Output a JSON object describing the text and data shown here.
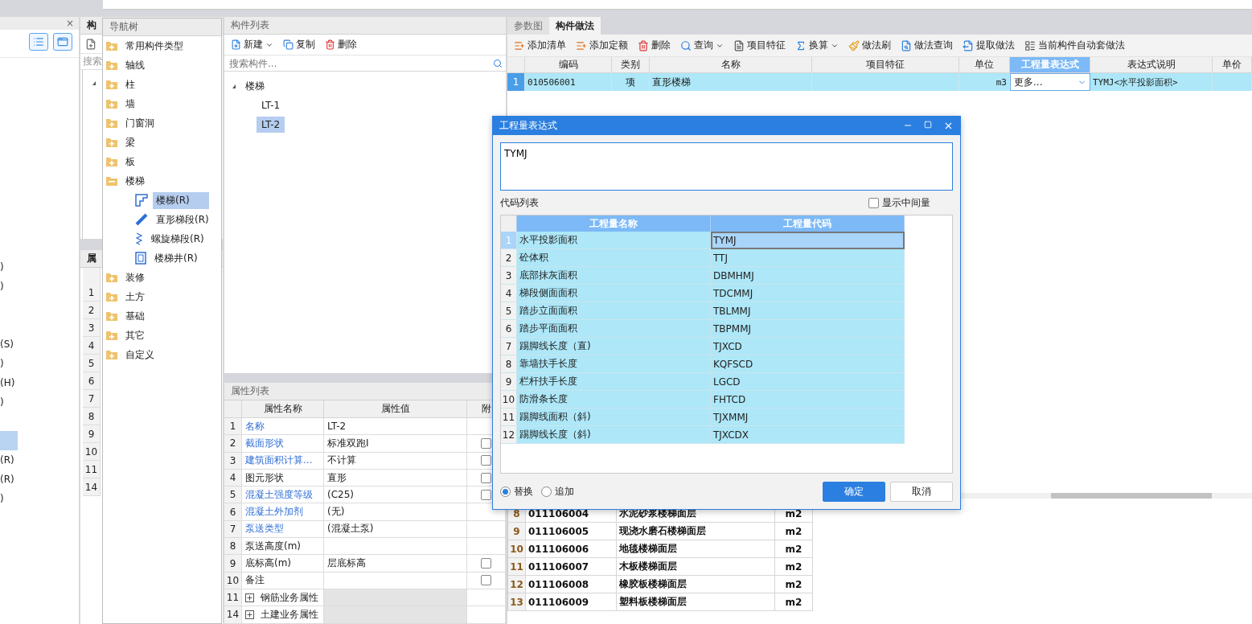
{
  "left_panel": {
    "close": "×",
    "rows": [
      {
        "text": ")",
        "selected": false
      },
      {
        "text": ")",
        "selected": false
      },
      {
        "selected": false
      },
      {
        "selected": false
      },
      {
        "text": "(S)",
        "selected": false
      },
      {
        "text": ")",
        "selected": false
      },
      {
        "text": "(H)",
        "selected": false
      },
      {
        "text": ")",
        "selected": false
      },
      {
        "selected": false
      },
      {
        "selected": true
      },
      {
        "text": "(R)",
        "selected": false
      },
      {
        "text": "(R)",
        "selected": false
      },
      {
        "text": ")",
        "selected": false
      }
    ]
  },
  "component_panel": {
    "title": "构",
    "search": {
      "placeholder": "搜索"
    },
    "properties_title": "属",
    "row_numbers": [
      "1",
      "2",
      "3",
      "4",
      "5",
      "6",
      "7",
      "8",
      "9",
      "10",
      "11",
      "14"
    ]
  },
  "nav_tree": {
    "title": "导航树",
    "items": [
      {
        "label": "常用构件类型",
        "expanded": false
      },
      {
        "label": "轴线",
        "expanded": false
      },
      {
        "label": "柱",
        "expanded": false
      },
      {
        "label": "墙",
        "expanded": false
      },
      {
        "label": "门窗洞",
        "expanded": false
      },
      {
        "label": "梁",
        "expanded": false
      },
      {
        "label": "板",
        "expanded": false
      },
      {
        "label": "楼梯",
        "expanded": true,
        "children": [
          {
            "label": "楼梯(R)",
            "selected": true
          },
          {
            "label": "直形梯段(R)",
            "selected": false
          },
          {
            "label": "螺旋梯段(R)",
            "selected": false
          },
          {
            "label": "楼梯井(R)",
            "selected": false
          }
        ]
      },
      {
        "label": "装修",
        "expanded": false
      },
      {
        "label": "土方",
        "expanded": false
      },
      {
        "label": "基础",
        "expanded": false
      },
      {
        "label": "其它",
        "expanded": false
      },
      {
        "label": "自定义",
        "expanded": false
      }
    ]
  },
  "component_list": {
    "title": "构件列表",
    "toolbar": [
      {
        "label": "新建",
        "dropdown": true
      },
      {
        "label": "复制",
        "dropdown": false
      },
      {
        "label": "删除",
        "dropdown": false
      }
    ],
    "search": {
      "placeholder": "搜索构件..."
    },
    "tree": [
      {
        "label": "楼梯",
        "expanded": true,
        "children": [
          {
            "label": "LT-1",
            "selected": false
          },
          {
            "label": "LT-2",
            "selected": true
          }
        ]
      }
    ]
  },
  "property_list": {
    "title": "属性列表",
    "columns": [
      "属性名称",
      "属性值",
      "附"
    ],
    "rows": [
      {
        "num": "1",
        "kind": "field",
        "name": "名称",
        "value": "LT-2",
        "public": true
      },
      {
        "num": "2",
        "kind": "field",
        "name": "截面形状",
        "value": "标准双跑I",
        "public": true,
        "checked": false
      },
      {
        "num": "3",
        "kind": "field",
        "name": "建筑面积计算...",
        "value": "不计算",
        "public": true,
        "checked": false
      },
      {
        "num": "4",
        "kind": "field",
        "name": "图元形状",
        "value": "直形",
        "public": false,
        "checked": false
      },
      {
        "num": "5",
        "kind": "field",
        "name": "混凝土强度等级",
        "value": "(C25)",
        "public": true,
        "checked": false
      },
      {
        "num": "6",
        "kind": "field",
        "name": "混凝土外加剂",
        "value": "(无)",
        "public": true
      },
      {
        "num": "7",
        "kind": "field",
        "name": "泵送类型",
        "value": "(混凝土泵)",
        "public": true
      },
      {
        "num": "8",
        "kind": "field",
        "name": "泵送高度(m)",
        "public": false
      },
      {
        "num": "9",
        "kind": "field",
        "name": "底标高(m)",
        "value": "层底标高",
        "public": false,
        "checked": false
      },
      {
        "num": "10",
        "kind": "field",
        "name": "备注",
        "public": false,
        "checked": false
      },
      {
        "num": "11",
        "kind": "group",
        "name": "钢筋业务属性",
        "public": false
      },
      {
        "num": "14",
        "kind": "group",
        "name": "土建业务属性",
        "public": false
      }
    ]
  },
  "method_panel": {
    "tabs": [
      {
        "label": "参数图",
        "selected": false
      },
      {
        "label": "构件做法",
        "selected": true
      }
    ],
    "toolbar": [
      {
        "label": "添加清单",
        "dropdown": false
      },
      {
        "label": "添加定额",
        "dropdown": false
      },
      {
        "label": "删除",
        "dropdown": false
      },
      {
        "label": "查询",
        "dropdown": true
      },
      {
        "label": "项目特征",
        "dropdown": false
      },
      {
        "label": "换算",
        "dropdown": true
      },
      {
        "label": "做法刷",
        "dropdown": false
      },
      {
        "label": "做法查询",
        "dropdown": false
      },
      {
        "label": "提取做法",
        "dropdown": false
      },
      {
        "label": "当前构件自动套做法",
        "dropdown": false
      }
    ],
    "columns": [
      {
        "label": "编码",
        "selected": false
      },
      {
        "label": "类别",
        "selected": false
      },
      {
        "label": "名称",
        "selected": false
      },
      {
        "label": "项目特征",
        "selected": false
      },
      {
        "label": "单位",
        "selected": false
      },
      {
        "label": "工程量表达式",
        "selected": true
      },
      {
        "label": "表达式说明",
        "selected": false
      },
      {
        "label": "单价",
        "selected": false
      }
    ],
    "rows": [
      {
        "num": "1",
        "code": "010506001",
        "category": "项",
        "name": "直形楼梯",
        "unit": "m3",
        "expression": "更多...",
        "description": "TYMJ<水平投影面积>",
        "selected": true
      }
    ],
    "lower_rows": [
      {
        "num": "8",
        "code": "011106004",
        "name": "水泥砂浆楼梯面层",
        "unit": "m2"
      },
      {
        "num": "9",
        "code": "011106005",
        "name": "现浇水磨石楼梯面层",
        "unit": "m2"
      },
      {
        "num": "10",
        "code": "011106006",
        "name": "地毯楼梯面层",
        "unit": "m2"
      },
      {
        "num": "11",
        "code": "011106007",
        "name": "木板楼梯面层",
        "unit": "m2"
      },
      {
        "num": "12",
        "code": "011106008",
        "name": "橡胶板楼梯面层",
        "unit": "m2"
      },
      {
        "num": "13",
        "code": "011106009",
        "name": "塑料板楼梯面层",
        "unit": "m2"
      }
    ]
  },
  "dialog": {
    "title": "工程量表达式",
    "expression": "TYMJ",
    "list_label": "代码列表",
    "show_intermediate": {
      "label": "显示中间量",
      "checked": false
    },
    "columns": [
      "工程量名称",
      "工程量代码"
    ],
    "rows": [
      {
        "num": "1",
        "name": "水平投影面积",
        "code": "TYMJ",
        "selected": true
      },
      {
        "num": "2",
        "name": "砼体积",
        "code": "TTJ",
        "selected": false
      },
      {
        "num": "3",
        "name": "底部抹灰面积",
        "code": "DBMHMJ",
        "selected": false
      },
      {
        "num": "4",
        "name": "梯段侧面面积",
        "code": "TDCMMJ",
        "selected": false
      },
      {
        "num": "5",
        "name": "踏步立面面积",
        "code": "TBLMMJ",
        "selected": false
      },
      {
        "num": "6",
        "name": "踏步平面面积",
        "code": "TBPMMJ",
        "selected": false
      },
      {
        "num": "7",
        "name": "踢脚线长度（直)",
        "code": "TJXCD",
        "selected": false
      },
      {
        "num": "8",
        "name": "靠墙扶手长度",
        "code": "KQFSCD",
        "selected": false
      },
      {
        "num": "9",
        "name": "栏杆扶手长度",
        "code": "LGCD",
        "selected": false
      },
      {
        "num": "10",
        "name": "防滑条长度",
        "code": "FHTCD",
        "selected": false
      },
      {
        "num": "11",
        "name": "踢脚线面积（斜)",
        "code": "TJXMMJ",
        "selected": false
      },
      {
        "num": "12",
        "name": "踢脚线长度（斜)",
        "code": "TJXCDX",
        "selected": false
      }
    ],
    "modes": [
      {
        "label": "替换",
        "selected": true
      },
      {
        "label": "追加",
        "selected": false
      }
    ],
    "buttons": [
      {
        "label": "确定",
        "kind": "primary"
      },
      {
        "label": "取消",
        "kind": "secondary"
      }
    ]
  }
}
